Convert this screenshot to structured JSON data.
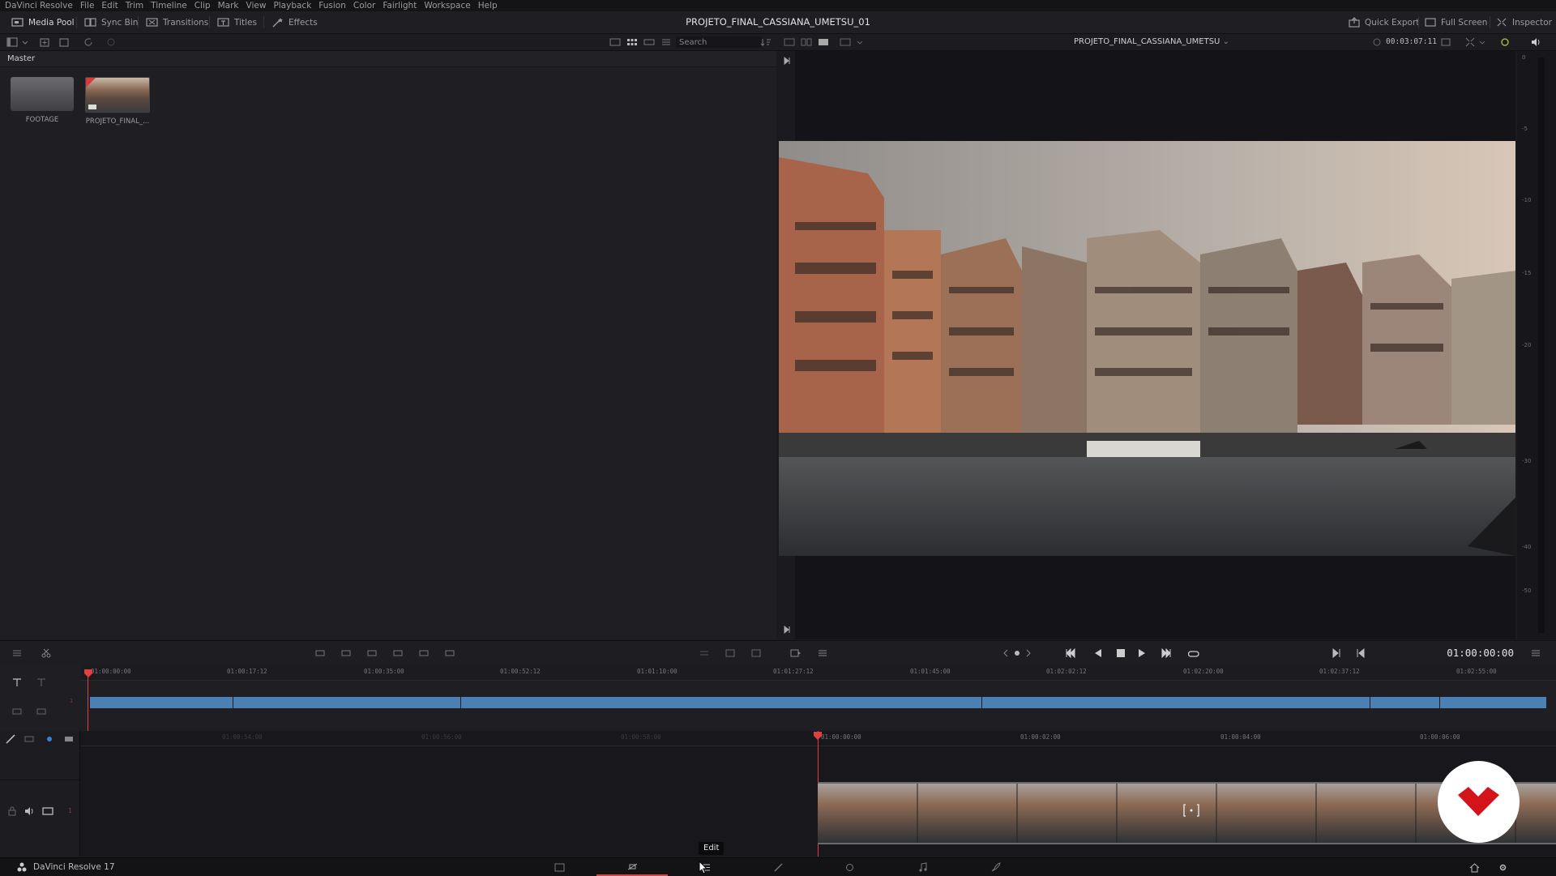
{
  "menu": [
    "DaVinci Resolve",
    "File",
    "Edit",
    "Trim",
    "Timeline",
    "Clip",
    "Mark",
    "View",
    "Playback",
    "Fusion",
    "Color",
    "Fairlight",
    "Workspace",
    "Help"
  ],
  "toolbar": {
    "media_pool": "Media Pool",
    "sync_bin": "Sync Bin",
    "transitions": "Transitions",
    "titles": "Titles",
    "effects": "Effects",
    "project_title": "PROJETO_FINAL_CASSIANA_UMETSU_01",
    "quick_export": "Quick Export",
    "full_screen": "Full Screen",
    "inspector": "Inspector"
  },
  "toolbar2": {
    "search_placeholder": "Search",
    "timeline_name": "PROJETO_FINAL_CASSIANA_UMETSU",
    "source_timecode": "00:03:07:11"
  },
  "media_pool": {
    "bin": "Master",
    "items": [
      {
        "label": "FOOTAGE",
        "type": "folder"
      },
      {
        "label": "PROJETO_FINAL_...",
        "type": "timeline"
      }
    ]
  },
  "meters": [
    "0",
    "-5",
    "-10",
    "-15",
    "-20",
    "-30",
    "-40",
    "-50"
  ],
  "transport": {
    "timecode": "01:00:00:00"
  },
  "timeline_top": {
    "ruler": [
      "01:00:00:00",
      "01:00:17:12",
      "01:00:35:00",
      "01:00:52:12",
      "01:01:10:00",
      "01:01:27:12",
      "01:01:45:00",
      "01:02:02:12",
      "01:02:20:00",
      "01:02:37:12",
      "01:02:55:00"
    ],
    "track_number": "1"
  },
  "timeline_bottom": {
    "ruler_faded": [
      "01:00:54:00",
      "01:00:56:00",
      "01:00:58:00"
    ],
    "ruler": [
      "01:00:00:00",
      "01:00:02:00",
      "01:00:04:00",
      "01:00:06:00"
    ],
    "track_number": "1"
  },
  "page_tabs": {
    "app_name": "DaVinci Resolve 17",
    "tooltip": "Edit"
  },
  "colors": {
    "accent_red": "#e04040",
    "clip_blue": "#4a80b3",
    "logo_red": "#d4141b"
  }
}
